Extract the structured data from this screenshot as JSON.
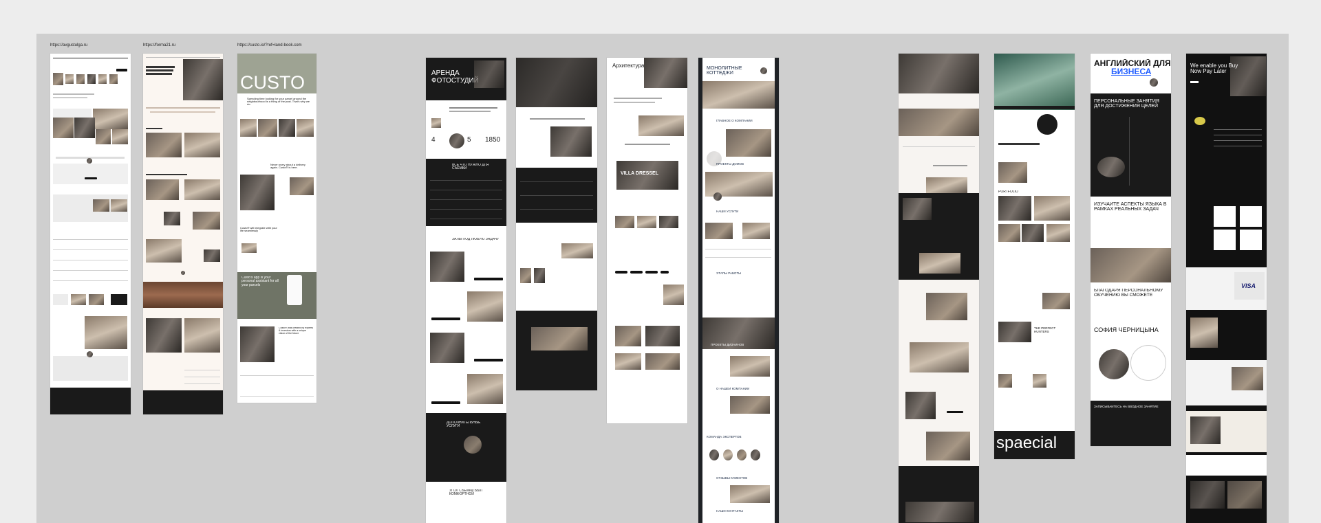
{
  "board": {
    "urls": [
      "https://avgustulga.ru",
      "https://forma21.ru",
      "https://custo.io/?ref=land-book.com"
    ]
  },
  "frames": {
    "f3": {
      "logo": "CUSTO",
      "line1": "Spending time looking for your parcel around the neighbourhood is a thing of the past. That's why we do.",
      "line2": "Never worry about a delivery again. Custo® is here.",
      "line3": "Custo® will integrate with your life seamlessly",
      "line4": "Custo's app is your personal assistant for all your parcels",
      "line5": "Custo® was created by experts & investors with a unique vision of the future"
    },
    "f4": {
      "title": "АРЕНДА ФОТОСТУДИЙ",
      "stat1": "4",
      "stat2": "5",
      "stat3": "1850",
      "s1": "ВСЁ ЧТО НУЖНО ДЛЯ СЪЁМКИ",
      "s2": "ЗАЛЫ ПОД ЛЮБУЮ ЗАДАЧУ",
      "s3": "ДОПОЛНИТЕЛЬНЫЕ УСЛУГИ",
      "s4": "УГОЛ СЪЁМКИ БЫЛ КОМФОРТНОЙ"
    },
    "f6": {
      "title": "Архитектура",
      "band": "VILLA DRESSEL"
    },
    "f7": {
      "title": "МОНОЛИТНЫЕ КОТТЕДЖИ",
      "s1": "ГЛАВНОЕ О КОМПАНИИ",
      "s2": "ПРОЕКТЫ ДОМОВ",
      "s3": "НАШИ УСЛУГИ",
      "s4": "ЭТАПЫ РАБОТЫ",
      "s5": "ПРОЕКТЫ ДИЗАЙНОВ",
      "s6": "О НАШЕЙ КОМПАНИИ",
      "s7": "КОМАНДА ЭКСПЕРТОВ",
      "s8": "ОТЗЫВЫ КЛИЕНТОВ",
      "s9": "НАШИ КОНТАКТЫ"
    },
    "f9": {
      "big": "spaecial",
      "l1": "PORTFOLIO",
      "l2": "THE PERFECT HUNTERS"
    },
    "f10": {
      "title1": "АНГЛИЙСКИЙ ДЛЯ",
      "title2": "БИЗНЕСА",
      "dark": "ПЕРСОНАЛЬНЫЕ ЗАНЯТИЯ ДЛЯ ДОСТИЖЕНИЯ ЦЕЛЕЙ",
      "s2": "ИЗУЧАЙТЕ АСПЕКТЫ ЯЗЫКА В РАМКАХ РЕАЛЬНЫХ ЗАДАЧ",
      "s3": "БЛАГОДАРЯ ПЕРСОНАЛЬНОМУ ОБУЧЕНИЮ ВЫ СМОЖЕТЕ",
      "name": "СОФИЯ ЧЕРНИЦЫНА",
      "cta": "ЗАПИСЫВАЙТЕСЬ НА ВВОДНОЕ ЗАНЯТИЕ"
    },
    "f11": {
      "title": "We enable you Buy Now Pay Later",
      "visa": "VISA"
    }
  },
  "colors": {
    "board": "#cfcfcf",
    "canvas": "#ededed",
    "dark": "#1a1a1a",
    "accent_blue": "#1f5cff",
    "sage": "#9ea393",
    "custo_green": "#6f7466"
  }
}
